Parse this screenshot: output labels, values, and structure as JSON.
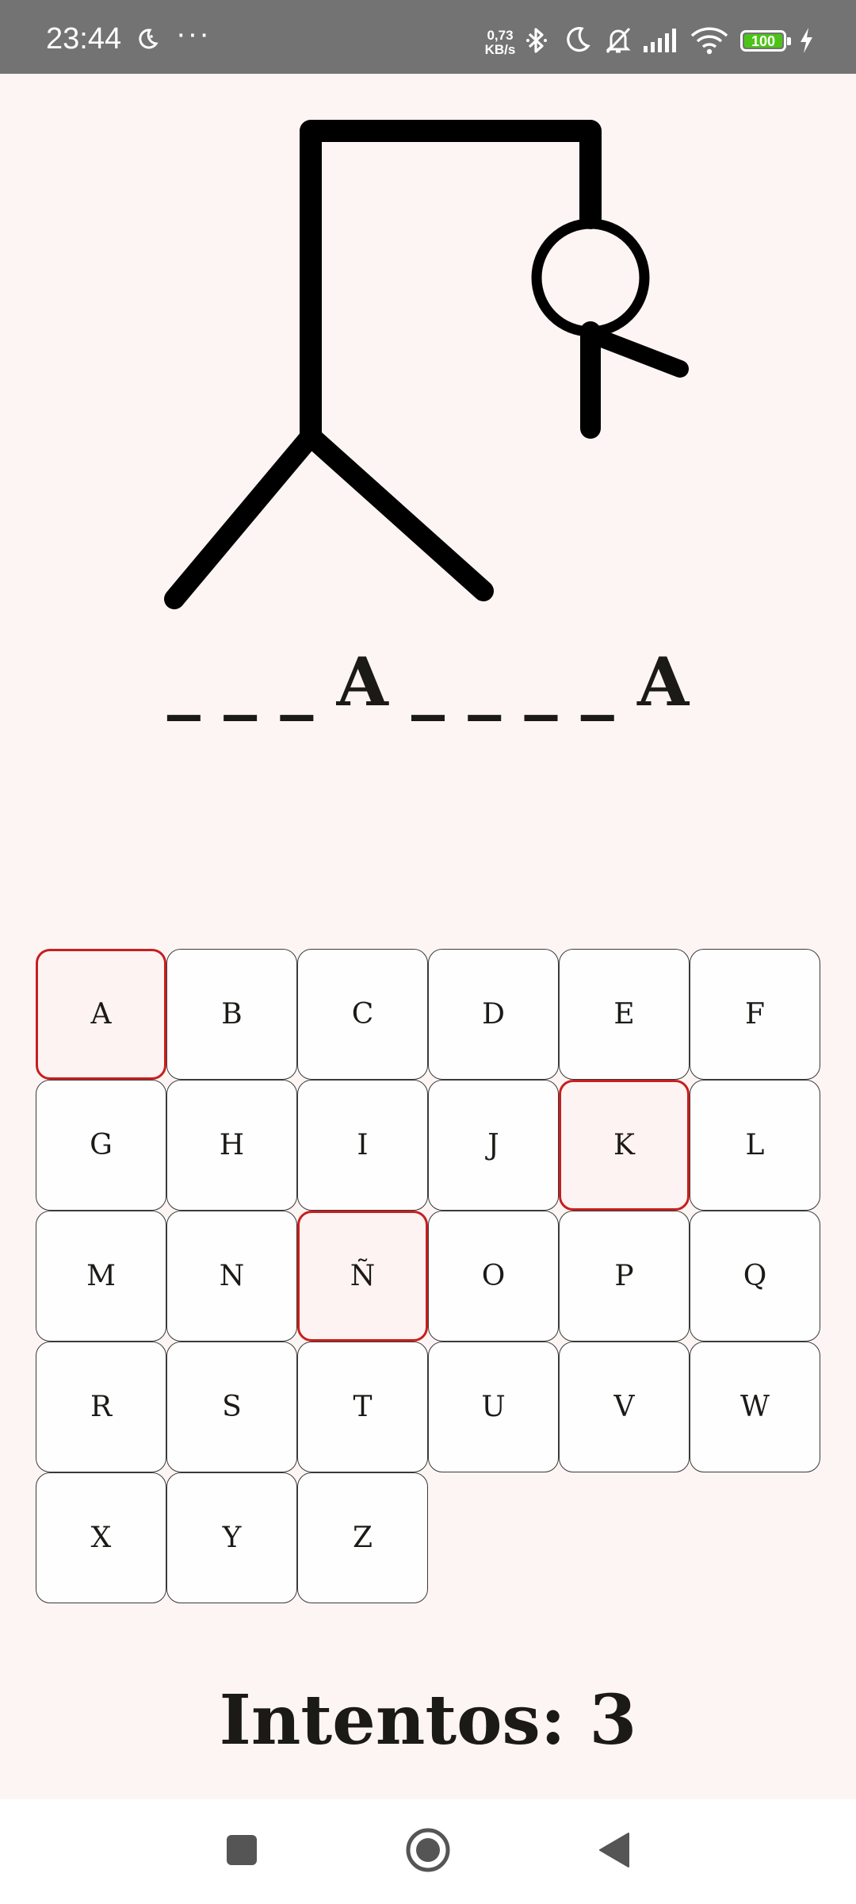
{
  "status_bar": {
    "time": "23:44",
    "speed_value": "0,73",
    "speed_unit": "KB/s",
    "battery": "100",
    "icons": [
      "moon-icon",
      "more-icon",
      "bluetooth-icon",
      "do-not-disturb-icon",
      "bell-off-icon",
      "signal-icon",
      "wifi-icon",
      "battery-icon",
      "charging-icon"
    ]
  },
  "game": {
    "word_display": "_ _ _ A _ _ _ _ A",
    "keys": [
      {
        "label": "A",
        "used": true
      },
      {
        "label": "B",
        "used": false
      },
      {
        "label": "C",
        "used": false
      },
      {
        "label": "D",
        "used": false
      },
      {
        "label": "E",
        "used": false
      },
      {
        "label": "F",
        "used": false
      },
      {
        "label": "G",
        "used": false
      },
      {
        "label": "H",
        "used": false
      },
      {
        "label": "I",
        "used": false
      },
      {
        "label": "J",
        "used": false
      },
      {
        "label": "K",
        "used": true
      },
      {
        "label": "L",
        "used": false
      },
      {
        "label": "M",
        "used": false
      },
      {
        "label": "N",
        "used": false
      },
      {
        "label": "Ñ",
        "used": true
      },
      {
        "label": "O",
        "used": false
      },
      {
        "label": "P",
        "used": false
      },
      {
        "label": "Q",
        "used": false
      },
      {
        "label": "R",
        "used": false
      },
      {
        "label": "S",
        "used": false
      },
      {
        "label": "T",
        "used": false
      },
      {
        "label": "U",
        "used": false
      },
      {
        "label": "V",
        "used": false
      },
      {
        "label": "W",
        "used": false
      },
      {
        "label": "X",
        "used": false
      },
      {
        "label": "Y",
        "used": false
      },
      {
        "label": "Z",
        "used": false
      }
    ],
    "attempts_text": "Intentos: 3"
  },
  "colors": {
    "background": "#fdf5f3",
    "used_key_border": "#c81e1e",
    "text": "#1b1a17"
  },
  "nav_bar": {
    "buttons": [
      "recents-button",
      "home-button",
      "back-button"
    ]
  }
}
